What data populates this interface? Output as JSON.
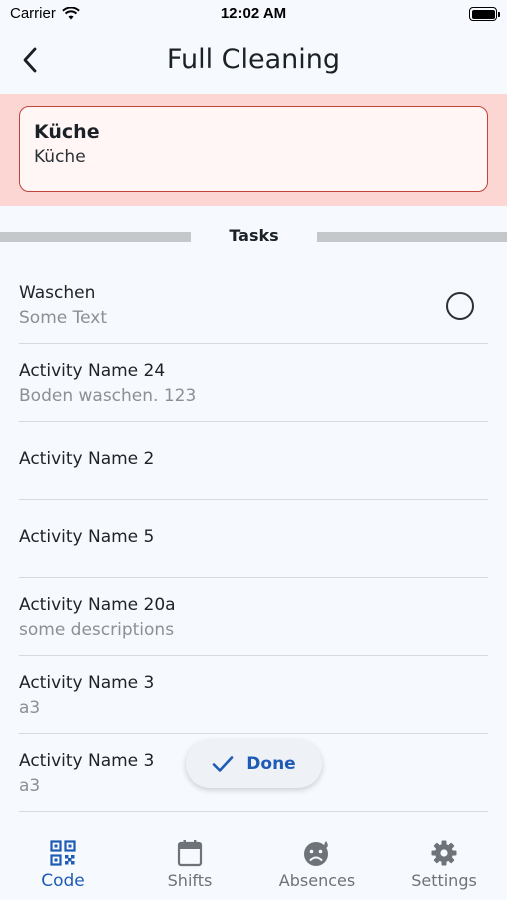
{
  "status_bar": {
    "carrier": "Carrier",
    "time": "12:02 AM"
  },
  "header": {
    "title": "Full Cleaning"
  },
  "location": {
    "title": "Küche",
    "subtitle": "Küche"
  },
  "section": {
    "title": "Tasks"
  },
  "tasks": [
    {
      "name": "Waschen",
      "description": "Some Text",
      "has_check": true
    },
    {
      "name": "Activity Name 24",
      "description": "Boden waschen. 123"
    },
    {
      "name": "Activity Name 2",
      "description": ""
    },
    {
      "name": "Activity Name 5",
      "description": ""
    },
    {
      "name": "Activity Name 20a",
      "description": "some descriptions"
    },
    {
      "name": "Activity Name 3",
      "description": "a3"
    },
    {
      "name": "Activity Name 3",
      "description": "a3"
    }
  ],
  "done_button": {
    "label": "Done",
    "icon": "checkmark-icon"
  },
  "tab_bar": {
    "active_color": "#1f5bb5",
    "tabs": [
      {
        "label": "Code",
        "icon": "qr-code-icon",
        "active": true
      },
      {
        "label": "Shifts",
        "icon": "calendar-icon",
        "active": false
      },
      {
        "label": "Absences",
        "icon": "sad-face-icon",
        "active": false
      },
      {
        "label": "Settings",
        "icon": "gear-icon",
        "active": false
      }
    ]
  }
}
